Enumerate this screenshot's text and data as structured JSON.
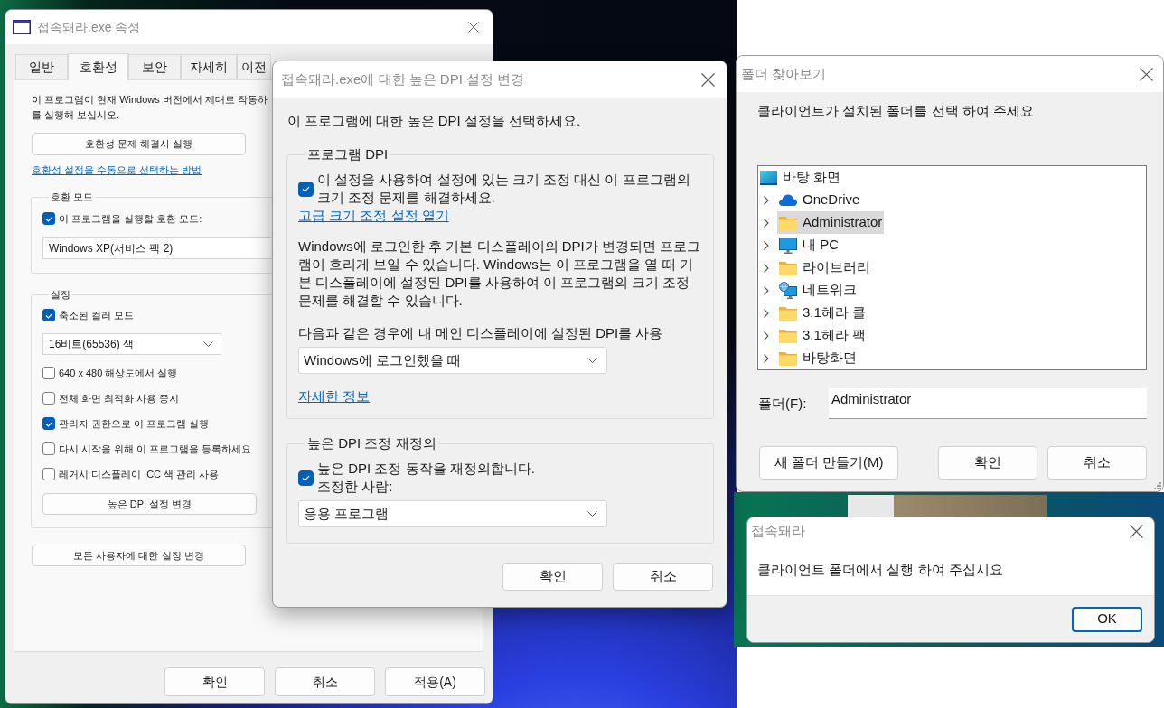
{
  "properties_window": {
    "title": "접속돼라.exe 속성",
    "tabs": [
      {
        "label": "일반",
        "selected": false
      },
      {
        "label": "호환성",
        "selected": true
      },
      {
        "label": "보안",
        "selected": false
      },
      {
        "label": "자세히",
        "selected": false
      },
      {
        "label": "이전",
        "selected": false
      }
    ],
    "intro": [
      "이 프로그램이 현재 Windows 버전에서 제대로 작동하",
      "를 실행해 보십시오."
    ],
    "troubleshooter_button": "호환성 문제 해결사 실행",
    "help_link": "호환성 설정을 수동으로 선택하는 방법",
    "compatibility_mode": {
      "title": "호환 모드",
      "checkbox": {
        "label": "이 프로그램을 실행할 호환 모드:",
        "checked": true
      },
      "dropdown": {
        "value": "Windows XP(서비스 팩 2)"
      }
    },
    "settings": {
      "title": "설정",
      "items": [
        {
          "kind": "checkbox",
          "label": "축소된 컬러 모드",
          "checked": true
        },
        {
          "kind": "dropdown",
          "value": "16비트(65536) 색"
        },
        {
          "kind": "checkbox",
          "label": "640 x 480 해상도에서 실행",
          "checked": false
        },
        {
          "kind": "checkbox",
          "label": "전체 화면 최적화 사용 중지",
          "checked": false
        },
        {
          "kind": "checkbox",
          "label": "관리자 권한으로 이 프로그램 실행",
          "checked": true
        },
        {
          "kind": "checkbox",
          "label": "다시 시작을 위해 이 프로그램을 등록하세요",
          "checked": false
        },
        {
          "kind": "checkbox",
          "label": "레거시 디스플레이 ICC 색 관리 사용",
          "checked": false
        },
        {
          "kind": "button",
          "label": "높은 DPI 설정 변경"
        }
      ]
    },
    "all_users_button": "모든 사용자에 대한 설정 변경",
    "buttons": [
      "확인",
      "취소",
      "적용(A)"
    ]
  },
  "dpi_dialog": {
    "title": "접속돼라.exe에 대한 높은 DPI 설정 변경",
    "heading": "이 프로그램에 대한 높은 DPI 설정을 선택하세요.",
    "program_dpi": {
      "title": "프로그램 DPI",
      "checkbox": {
        "label_lines": [
          "이 설정을 사용하여 설정에 있는 크기 조정 대신 이 프로그램의",
          "크기 조정 문제를 해결하세요."
        ],
        "checked": true
      },
      "link": "고급 크기 조정 설정 열기",
      "description_lines": [
        "Windows에 로그인한 후 기본 디스플레이의 DPI가 변경되면 프로그",
        "램이 흐리게 보일 수 있습니다. Windows는 이 프로그램을 열 때 기",
        "본 디스플레이에 설정된 DPI를 사용하여 이 프로그램의 크기 조정",
        "문제를 해결할 수 있습니다."
      ],
      "dropdown_label": "다음과 같은 경우에 내 메인 디스플레이에 설정된 DPI를 사용",
      "dropdown": {
        "value": "Windows에 로그인했을 때"
      },
      "more_link": "자세한 정보"
    },
    "override": {
      "title": "높은 DPI 조정 재정의",
      "checkbox": {
        "label_lines": [
          "높은 DPI 조정 동작을 재정의합니다.",
          "조정한 사람:"
        ],
        "checked": true
      },
      "dropdown": {
        "value": "응용 프로그램"
      }
    },
    "buttons": [
      "확인",
      "취소"
    ]
  },
  "folder_dialog": {
    "title": "폴더 찾아보기",
    "message": "클라이언트가 설치된 폴더를 선택 하여 주세요",
    "tree": {
      "label": "바탕 화면",
      "kind": "desktop",
      "selected": false,
      "children": [
        {
          "label": "OneDrive",
          "kind": "cloud",
          "expanded": false,
          "selected": false
        },
        {
          "label": "Administrator",
          "kind": "folder",
          "expanded": false,
          "selected": true
        },
        {
          "label": "내 PC",
          "kind": "computer",
          "expanded": false,
          "selected": false
        },
        {
          "label": "라이브러리",
          "kind": "folder",
          "expanded": false,
          "selected": false
        },
        {
          "label": "네트워크",
          "kind": "network",
          "expanded": false,
          "selected": false
        },
        {
          "label": "3.1헤라 클",
          "kind": "folder",
          "expanded": false,
          "selected": false
        },
        {
          "label": "3.1헤라 팩",
          "kind": "folder",
          "expanded": false,
          "selected": false
        },
        {
          "label": "바탕화면",
          "kind": "folder",
          "expanded": false,
          "selected": false
        }
      ]
    },
    "folder_label": "폴더(F):",
    "folder_value": "Administrator",
    "buttons": [
      "새 폴더 만들기(M)",
      "확인",
      "취소"
    ]
  },
  "message_box": {
    "title": "접속돼라",
    "message": "클라이언트 폴더에서 실행 하여 주십시요",
    "button": {
      "label": "OK",
      "default": true
    }
  }
}
